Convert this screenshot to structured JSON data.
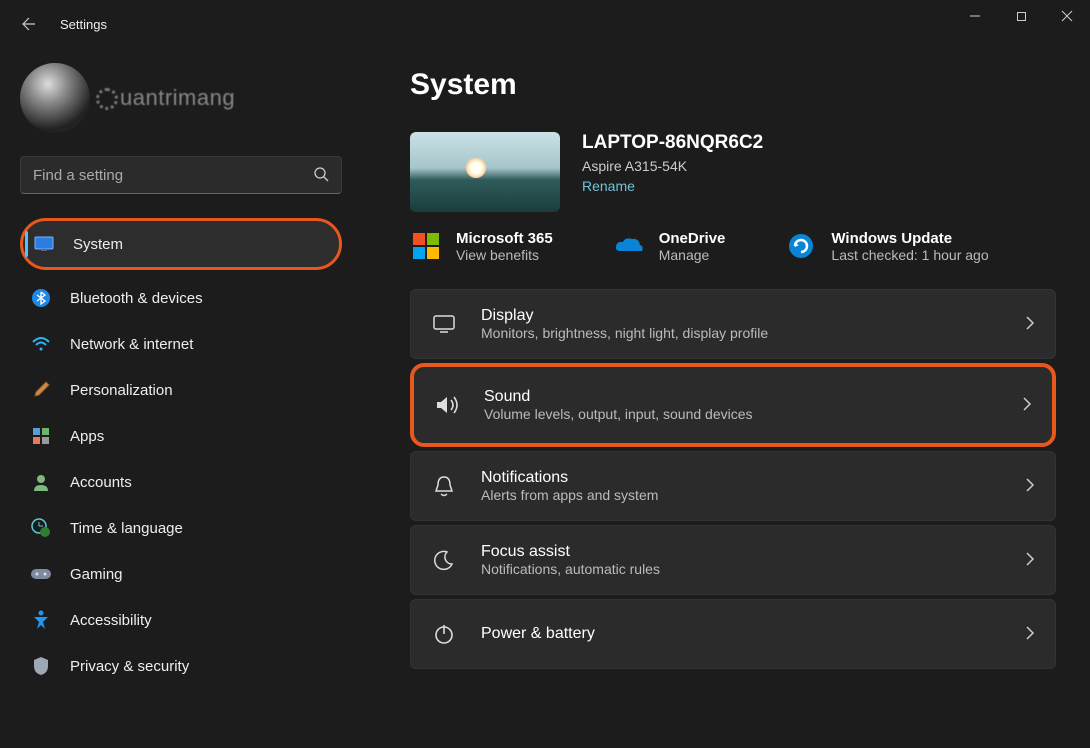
{
  "app_title": "Settings",
  "watermark": "uantrimang",
  "search": {
    "placeholder": "Find a setting"
  },
  "sidebar": {
    "items": [
      {
        "label": "System",
        "icon": "monitor-icon",
        "active": true
      },
      {
        "label": "Bluetooth & devices",
        "icon": "bluetooth-icon"
      },
      {
        "label": "Network & internet",
        "icon": "wifi-icon"
      },
      {
        "label": "Personalization",
        "icon": "brush-icon"
      },
      {
        "label": "Apps",
        "icon": "apps-icon"
      },
      {
        "label": "Accounts",
        "icon": "person-icon"
      },
      {
        "label": "Time & language",
        "icon": "clock-globe-icon"
      },
      {
        "label": "Gaming",
        "icon": "gamepad-icon"
      },
      {
        "label": "Accessibility",
        "icon": "accessibility-icon"
      },
      {
        "label": "Privacy & security",
        "icon": "shield-icon"
      }
    ]
  },
  "page": {
    "title": "System",
    "device": {
      "name": "LAPTOP-86NQR6C2",
      "model": "Aspire A315-54K",
      "rename": "Rename"
    },
    "services": [
      {
        "title": "Microsoft 365",
        "sub": "View benefits",
        "icon": "ms365-icon"
      },
      {
        "title": "OneDrive",
        "sub": "Manage",
        "icon": "onedrive-icon"
      },
      {
        "title": "Windows Update",
        "sub": "Last checked: 1 hour ago",
        "icon": "update-icon"
      }
    ],
    "tiles": [
      {
        "title": "Display",
        "sub": "Monitors, brightness, night light, display profile",
        "icon": "display-icon"
      },
      {
        "title": "Sound",
        "sub": "Volume levels, output, input, sound devices",
        "icon": "sound-icon",
        "highlight": true
      },
      {
        "title": "Notifications",
        "sub": "Alerts from apps and system",
        "icon": "bell-icon"
      },
      {
        "title": "Focus assist",
        "sub": "Notifications, automatic rules",
        "icon": "moon-icon"
      },
      {
        "title": "Power & battery",
        "sub": "",
        "icon": "power-icon"
      }
    ]
  }
}
